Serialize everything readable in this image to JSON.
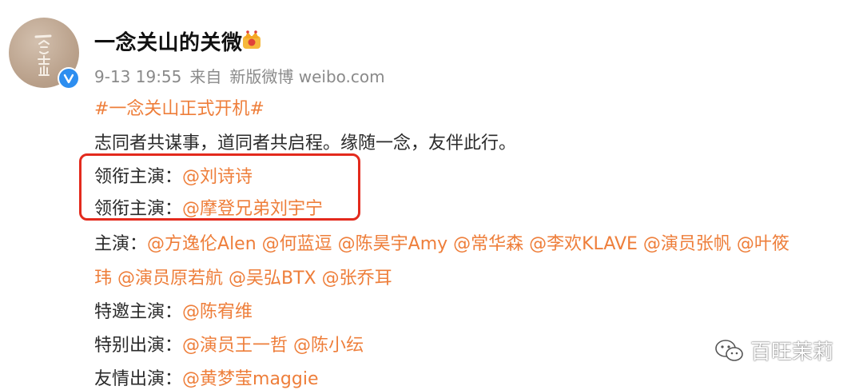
{
  "post": {
    "username": "一念关山的关微",
    "badge_icon": "crown-icon",
    "verified_icon": "verified-v-icon",
    "avatar_text": "一念关山",
    "timestamp": "9-13 19:55",
    "source_label": "来自",
    "source_value": "新版微博 weibo.com"
  },
  "content": {
    "hashtag": "#一念关山正式开机#",
    "intro": "志同者共谋事，道同者共启程。缘随一念，友伴此行。",
    "lead1_label": "领衔主演：",
    "lead1_mention": "@刘诗诗",
    "lead2_label": "领衔主演：",
    "lead2_mention": "@摩登兄弟刘宇宁",
    "main_label": "主演：",
    "main_line1": "@方逸伦Alen @何蓝逗 @陈昊宇Amy @常华森 @李欢KLAVE @演员张帆 @叶筱",
    "main_line2": "玮 @演员原若航 @吴弘BTX @张乔耳",
    "special_guest_label": "特邀主演：",
    "special_guest_mention": "@陈宥维",
    "special_label": "特别出演：",
    "special_mentions": "@演员王一哲 @陈小纭",
    "friend_label": "友情出演：",
    "friend_mention": "@黄梦莹maggie"
  },
  "watermark": {
    "text": "百旺茉莉",
    "icon": "wechat-icon"
  },
  "colors": {
    "mention": "#ee7e3a",
    "highlight_box": "#e32a1d",
    "verified": "#2d8ef0",
    "meta_text": "#8a8a8a"
  }
}
